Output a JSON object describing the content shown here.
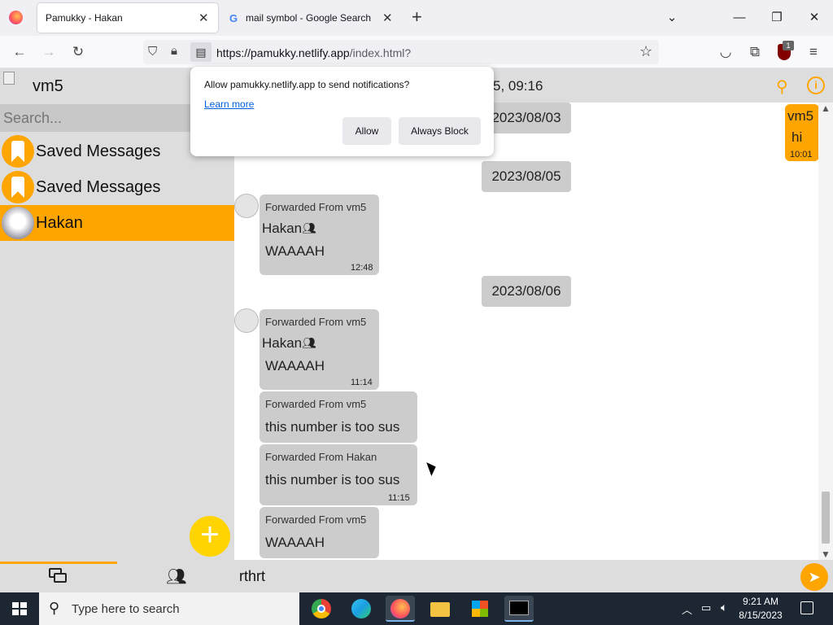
{
  "browser": {
    "tabs": [
      {
        "label": "Pamukky - Hakan",
        "active": true
      },
      {
        "label": "mail symbol - Google Search",
        "active": false
      }
    ],
    "url_host": "https://pamukky.netlify.app",
    "url_path": "/index.html?",
    "new_tab": "+",
    "extension_badge": "1"
  },
  "notification_prompt": {
    "title": "Allow pamukky.netlify.app to send notifications?",
    "learn_more": "Learn more",
    "allow": "Allow",
    "always_block": "Always Block"
  },
  "sidebar": {
    "title": "vm5",
    "search_placeholder": "Search...",
    "chats": [
      {
        "name": "Saved Messages",
        "selected": false
      },
      {
        "name": "Saved Messages",
        "selected": false
      },
      {
        "name": "Hakan",
        "selected": true
      }
    ],
    "fab": "+"
  },
  "chat_header": {
    "time": "5, 09:16"
  },
  "messages": {
    "own": {
      "sender": "vm5",
      "text": "hi",
      "time": "10:01"
    },
    "dates": [
      "2023/08/03",
      "2023/08/05",
      "2023/08/06"
    ],
    "m1": {
      "forward": "Forwarded From vm5",
      "name": "Hakan",
      "text": "WAAAAH",
      "time": "12:48"
    },
    "m2": {
      "forward": "Forwarded From vm5",
      "name": "Hakan",
      "text": "WAAAAH",
      "time": "11:14"
    },
    "m3": {
      "forward": "Forwarded From vm5",
      "text": "this number is too sus"
    },
    "m4": {
      "forward": "Forwarded From Hakan",
      "text": "this number is too sus",
      "time": "11:15"
    },
    "m5": {
      "forward": "Forwarded From vm5",
      "text": "WAAAAH"
    }
  },
  "composer": {
    "value": "rthrt"
  },
  "taskbar": {
    "search_placeholder": "Type here to search",
    "time": "9:21 AM",
    "date": "8/15/2023"
  },
  "colors": {
    "accent": "#ffa500",
    "fab": "#ffd400",
    "panel": "#dddddd",
    "bubble": "#cccccc"
  }
}
